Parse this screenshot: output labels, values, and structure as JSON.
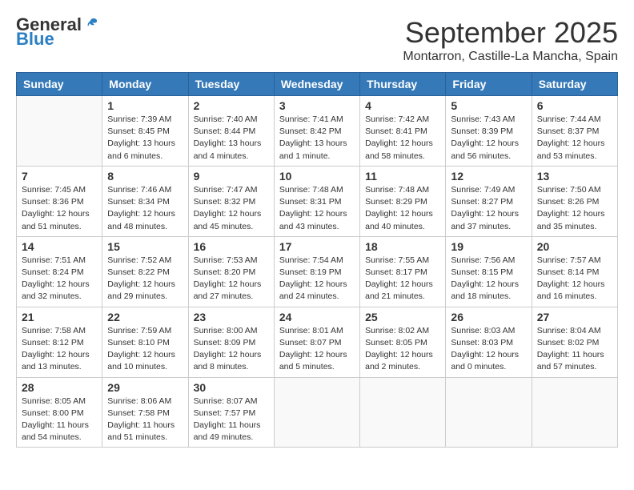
{
  "logo": {
    "general": "General",
    "blue": "Blue"
  },
  "title": "September 2025",
  "location": "Montarron, Castille-La Mancha, Spain",
  "weekdays": [
    "Sunday",
    "Monday",
    "Tuesday",
    "Wednesday",
    "Thursday",
    "Friday",
    "Saturday"
  ],
  "weeks": [
    [
      {
        "day": "",
        "info": ""
      },
      {
        "day": "1",
        "info": "Sunrise: 7:39 AM\nSunset: 8:45 PM\nDaylight: 13 hours\nand 6 minutes."
      },
      {
        "day": "2",
        "info": "Sunrise: 7:40 AM\nSunset: 8:44 PM\nDaylight: 13 hours\nand 4 minutes."
      },
      {
        "day": "3",
        "info": "Sunrise: 7:41 AM\nSunset: 8:42 PM\nDaylight: 13 hours\nand 1 minute."
      },
      {
        "day": "4",
        "info": "Sunrise: 7:42 AM\nSunset: 8:41 PM\nDaylight: 12 hours\nand 58 minutes."
      },
      {
        "day": "5",
        "info": "Sunrise: 7:43 AM\nSunset: 8:39 PM\nDaylight: 12 hours\nand 56 minutes."
      },
      {
        "day": "6",
        "info": "Sunrise: 7:44 AM\nSunset: 8:37 PM\nDaylight: 12 hours\nand 53 minutes."
      }
    ],
    [
      {
        "day": "7",
        "info": "Sunrise: 7:45 AM\nSunset: 8:36 PM\nDaylight: 12 hours\nand 51 minutes."
      },
      {
        "day": "8",
        "info": "Sunrise: 7:46 AM\nSunset: 8:34 PM\nDaylight: 12 hours\nand 48 minutes."
      },
      {
        "day": "9",
        "info": "Sunrise: 7:47 AM\nSunset: 8:32 PM\nDaylight: 12 hours\nand 45 minutes."
      },
      {
        "day": "10",
        "info": "Sunrise: 7:48 AM\nSunset: 8:31 PM\nDaylight: 12 hours\nand 43 minutes."
      },
      {
        "day": "11",
        "info": "Sunrise: 7:48 AM\nSunset: 8:29 PM\nDaylight: 12 hours\nand 40 minutes."
      },
      {
        "day": "12",
        "info": "Sunrise: 7:49 AM\nSunset: 8:27 PM\nDaylight: 12 hours\nand 37 minutes."
      },
      {
        "day": "13",
        "info": "Sunrise: 7:50 AM\nSunset: 8:26 PM\nDaylight: 12 hours\nand 35 minutes."
      }
    ],
    [
      {
        "day": "14",
        "info": "Sunrise: 7:51 AM\nSunset: 8:24 PM\nDaylight: 12 hours\nand 32 minutes."
      },
      {
        "day": "15",
        "info": "Sunrise: 7:52 AM\nSunset: 8:22 PM\nDaylight: 12 hours\nand 29 minutes."
      },
      {
        "day": "16",
        "info": "Sunrise: 7:53 AM\nSunset: 8:20 PM\nDaylight: 12 hours\nand 27 minutes."
      },
      {
        "day": "17",
        "info": "Sunrise: 7:54 AM\nSunset: 8:19 PM\nDaylight: 12 hours\nand 24 minutes."
      },
      {
        "day": "18",
        "info": "Sunrise: 7:55 AM\nSunset: 8:17 PM\nDaylight: 12 hours\nand 21 minutes."
      },
      {
        "day": "19",
        "info": "Sunrise: 7:56 AM\nSunset: 8:15 PM\nDaylight: 12 hours\nand 18 minutes."
      },
      {
        "day": "20",
        "info": "Sunrise: 7:57 AM\nSunset: 8:14 PM\nDaylight: 12 hours\nand 16 minutes."
      }
    ],
    [
      {
        "day": "21",
        "info": "Sunrise: 7:58 AM\nSunset: 8:12 PM\nDaylight: 12 hours\nand 13 minutes."
      },
      {
        "day": "22",
        "info": "Sunrise: 7:59 AM\nSunset: 8:10 PM\nDaylight: 12 hours\nand 10 minutes."
      },
      {
        "day": "23",
        "info": "Sunrise: 8:00 AM\nSunset: 8:09 PM\nDaylight: 12 hours\nand 8 minutes."
      },
      {
        "day": "24",
        "info": "Sunrise: 8:01 AM\nSunset: 8:07 PM\nDaylight: 12 hours\nand 5 minutes."
      },
      {
        "day": "25",
        "info": "Sunrise: 8:02 AM\nSunset: 8:05 PM\nDaylight: 12 hours\nand 2 minutes."
      },
      {
        "day": "26",
        "info": "Sunrise: 8:03 AM\nSunset: 8:03 PM\nDaylight: 12 hours\nand 0 minutes."
      },
      {
        "day": "27",
        "info": "Sunrise: 8:04 AM\nSunset: 8:02 PM\nDaylight: 11 hours\nand 57 minutes."
      }
    ],
    [
      {
        "day": "28",
        "info": "Sunrise: 8:05 AM\nSunset: 8:00 PM\nDaylight: 11 hours\nand 54 minutes."
      },
      {
        "day": "29",
        "info": "Sunrise: 8:06 AM\nSunset: 7:58 PM\nDaylight: 11 hours\nand 51 minutes."
      },
      {
        "day": "30",
        "info": "Sunrise: 8:07 AM\nSunset: 7:57 PM\nDaylight: 11 hours\nand 49 minutes."
      },
      {
        "day": "",
        "info": ""
      },
      {
        "day": "",
        "info": ""
      },
      {
        "day": "",
        "info": ""
      },
      {
        "day": "",
        "info": ""
      }
    ]
  ]
}
